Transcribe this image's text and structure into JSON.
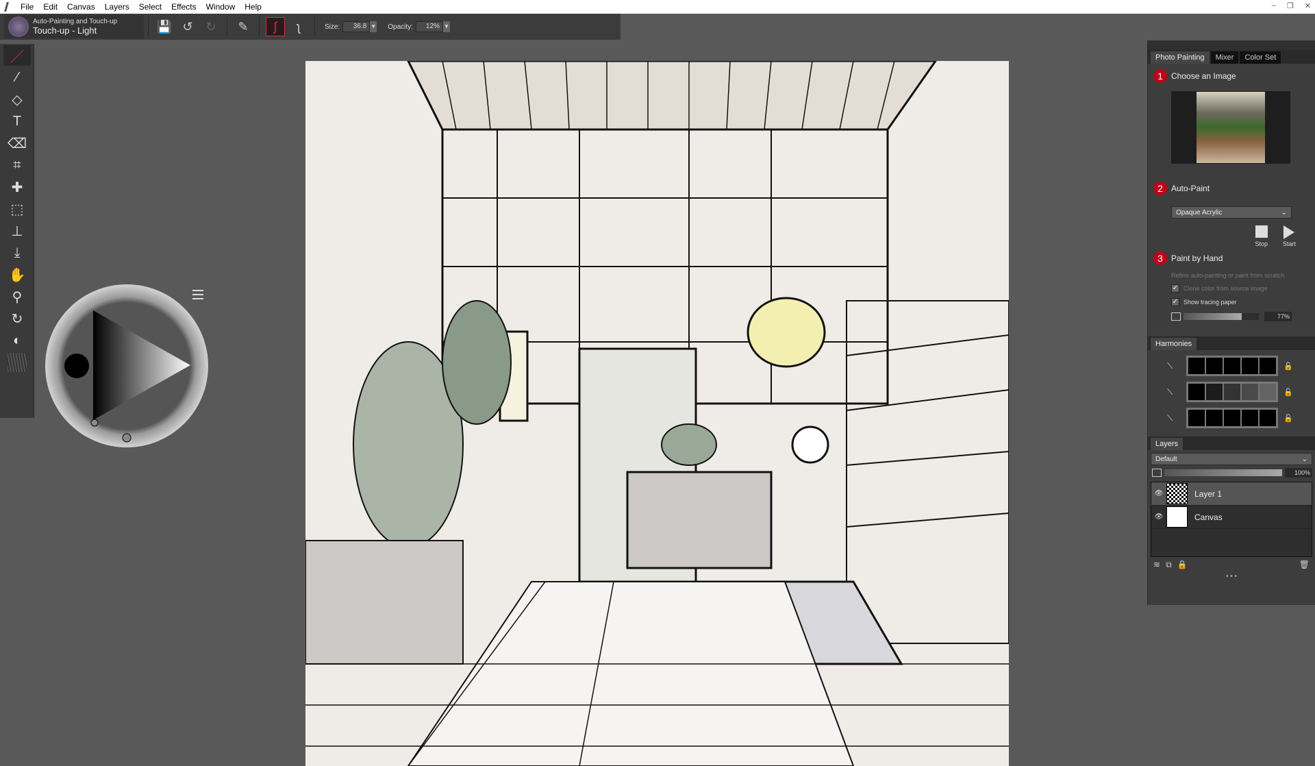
{
  "menu": {
    "items": [
      "File",
      "Edit",
      "Canvas",
      "Layers",
      "Select",
      "Effects",
      "Window",
      "Help"
    ]
  },
  "toolbar": {
    "brush_category": "Auto-Painting and Touch-up",
    "brush_name": "Touch-up - Light",
    "size_label": "Size:",
    "size_value": "36.8",
    "opacity_label": "Opacity:",
    "opacity_value": "12%"
  },
  "panel": {
    "tabs": [
      "Photo Painting",
      "Mixer",
      "Color Set"
    ],
    "step1": {
      "num": "1",
      "label": "Choose an Image"
    },
    "step2": {
      "num": "2",
      "label": "Auto-Paint",
      "style": "Opaque Acrylic",
      "stop": "Stop",
      "start": "Start"
    },
    "step3": {
      "num": "3",
      "label": "Paint by Hand",
      "hint": "Refine auto-painting or paint from scratch",
      "clone_label": "Clone color from source image",
      "clone_checked": true,
      "tracing_label": "Show tracing paper",
      "tracing_checked": true,
      "tracing_opacity": "77%"
    }
  },
  "harmonies": {
    "title": "Harmonies",
    "rows": [
      [
        "#000000",
        "#000000",
        "#000000",
        "#000000",
        "#000000"
      ],
      [
        "#000000",
        "#1c1c1c",
        "#333333",
        "#4a4a4a",
        "#636363"
      ],
      [
        "#000000",
        "#000000",
        "#000000",
        "#000000",
        "#000000"
      ]
    ]
  },
  "layers": {
    "title": "Layers",
    "composite": "Default",
    "opacity": "100%",
    "items": [
      {
        "name": "Layer 1",
        "selected": true
      },
      {
        "name": "Canvas",
        "selected": false
      }
    ]
  },
  "colors": {
    "accent": "#c00018",
    "background": "#595959",
    "panel": "#3d3d3d"
  }
}
